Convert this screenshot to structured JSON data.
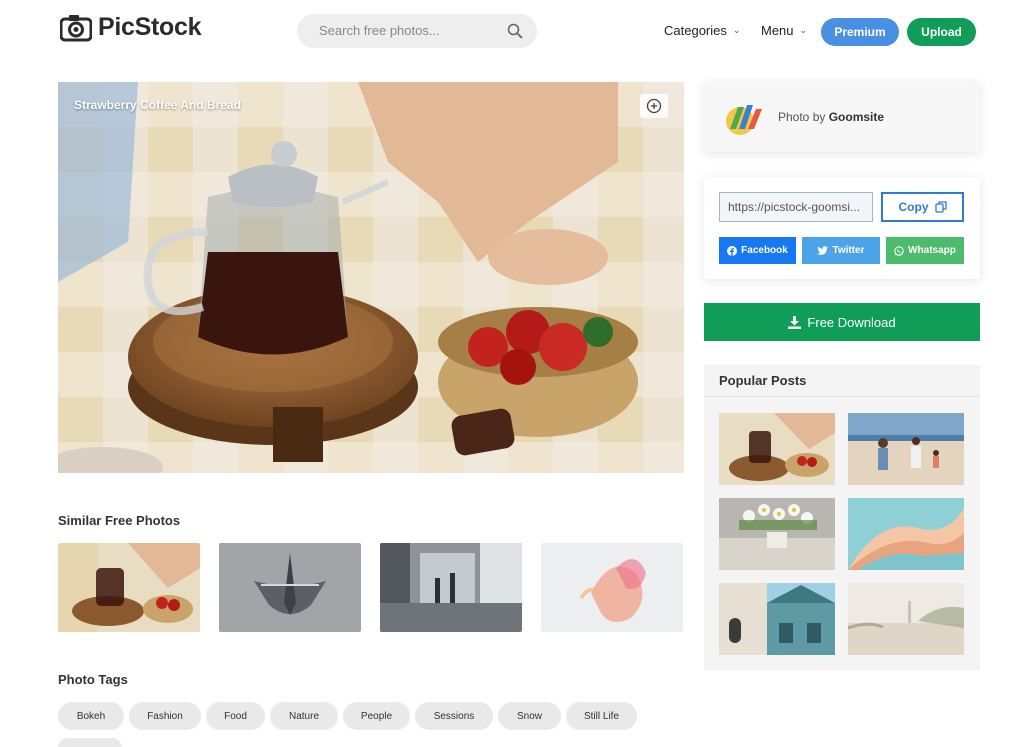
{
  "header": {
    "logo_text": "PicStock",
    "search_placeholder": "Search free photos...",
    "nav": {
      "categories": "Categories",
      "menu": "Menu"
    },
    "premium_label": "Premium",
    "upload_label": "Upload"
  },
  "photo": {
    "title": "Strawberry Coffee And Bread"
  },
  "similar": {
    "title": "Similar Free Photos"
  },
  "tags": {
    "title": "Photo Tags",
    "items": [
      "Bokeh",
      "Fashion",
      "Food",
      "Nature",
      "People",
      "Sessions",
      "Snow",
      "Still Life"
    ]
  },
  "author": {
    "prefix": "Photo by",
    "name": "Goomsite"
  },
  "share": {
    "url_value": "https://picstock-goomsi...",
    "copy_label": "Copy",
    "facebook_label": "Facebook",
    "twitter_label": "Twitter",
    "whatsapp_label": "Whatsapp"
  },
  "download_label": "Free Download",
  "popular": {
    "title": "Popular Posts"
  },
  "colors": {
    "premium": "#4a90e2",
    "upload": "#0f9d58",
    "facebook": "#1877f2",
    "twitter": "#4da3e8",
    "whatsapp": "#4cbb6c",
    "download": "#0f9d58"
  }
}
